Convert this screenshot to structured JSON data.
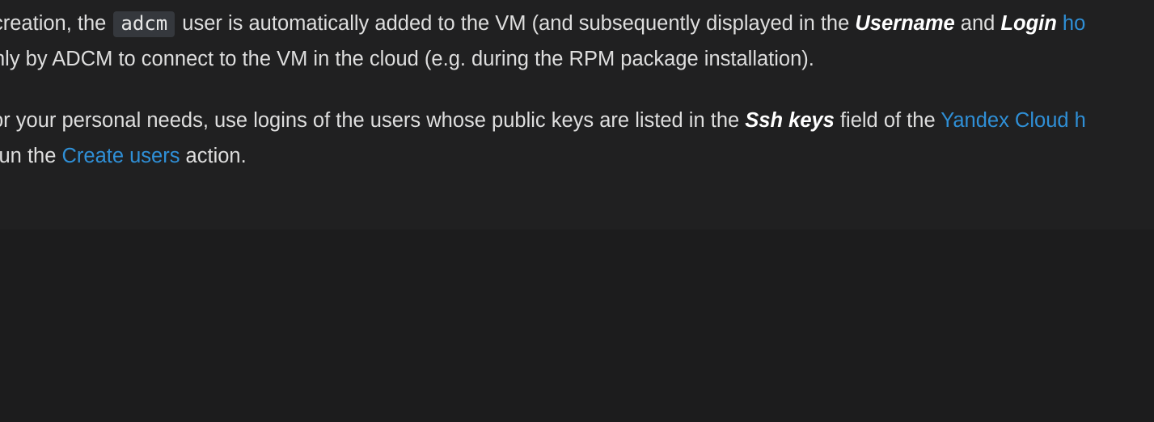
{
  "content": {
    "p1_line1": {
      "t1": "creation, the ",
      "code": "adcm",
      "t2": " user is automatically added to the VM (and subsequently displayed in the ",
      "em1": "Username",
      "t3": " and ",
      "em2": "Login",
      "t4": " ",
      "link": "ho"
    },
    "p1_line2": "nly by ADCM to connect to the VM in the cloud (e.g. during the RPM package installation).",
    "p2_line1": {
      "t1": "or your personal needs, use logins of the users whose public keys are listed in the ",
      "em1": "Ssh keys",
      "t2": " field of the ",
      "link": "Yandex Cloud h"
    },
    "p2_line2": {
      "t1": " run the ",
      "link": "Create users",
      "t2": " action."
    }
  },
  "colors": {
    "background": "#1c1c1d",
    "panel": "#202021",
    "text": "#dedede",
    "link": "#2f8fd6",
    "code_bg": "#35383d"
  }
}
